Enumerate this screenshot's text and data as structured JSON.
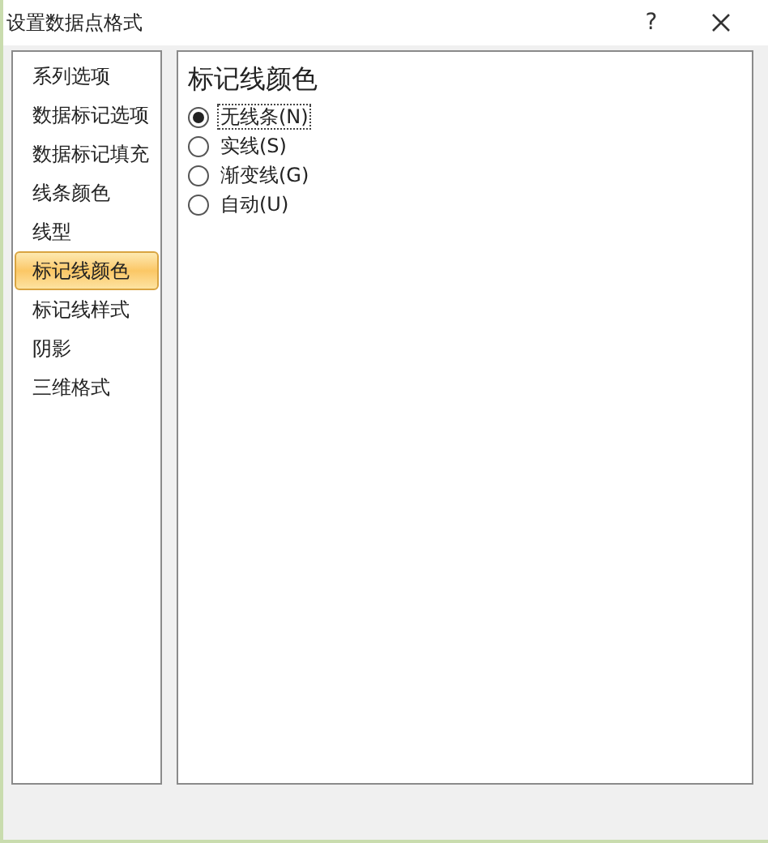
{
  "window": {
    "title": "设置数据点格式",
    "help": "?"
  },
  "sidebar": {
    "items": [
      {
        "label": "系列选项",
        "selected": false
      },
      {
        "label": "数据标记选项",
        "selected": false
      },
      {
        "label": "数据标记填充",
        "selected": false
      },
      {
        "label": "线条颜色",
        "selected": false
      },
      {
        "label": "线型",
        "selected": false
      },
      {
        "label": "标记线颜色",
        "selected": true
      },
      {
        "label": "标记线样式",
        "selected": false
      },
      {
        "label": "阴影",
        "selected": false
      },
      {
        "label": "三维格式",
        "selected": false
      }
    ]
  },
  "panel": {
    "heading": "标记线颜色",
    "options": [
      {
        "label": "无线条(N)",
        "selected": true
      },
      {
        "label": "实线(S)",
        "selected": false
      },
      {
        "label": "渐变线(G)",
        "selected": false
      },
      {
        "label": "自动(U)",
        "selected": false
      }
    ]
  }
}
